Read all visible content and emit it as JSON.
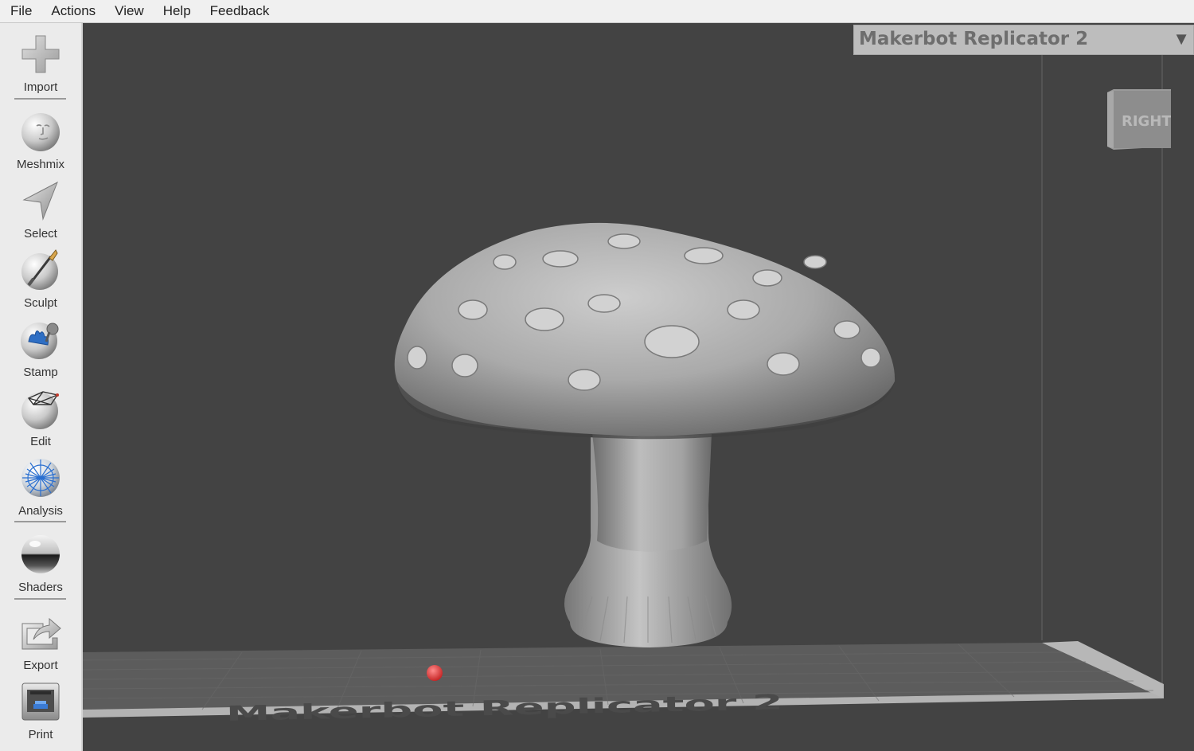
{
  "menubar": {
    "items": [
      "File",
      "Actions",
      "View",
      "Help",
      "Feedback"
    ]
  },
  "toolbar": {
    "items": [
      {
        "label": "Import",
        "icon": "plus-icon"
      },
      {
        "label": "Meshmix",
        "icon": "face-sphere-icon"
      },
      {
        "label": "Select",
        "icon": "arrow-cursor-icon"
      },
      {
        "label": "Sculpt",
        "icon": "brush-sphere-icon"
      },
      {
        "label": "Stamp",
        "icon": "stamp-sphere-icon"
      },
      {
        "label": "Edit",
        "icon": "mesh-edit-icon"
      },
      {
        "label": "Analysis",
        "icon": "mesh-analysis-icon"
      },
      {
        "label": "Shaders",
        "icon": "chrome-sphere-icon"
      },
      {
        "label": "Export",
        "icon": "export-icon"
      },
      {
        "label": "Print",
        "icon": "printer-icon"
      }
    ]
  },
  "viewport": {
    "printer_select": {
      "value": "Makerbot Replicator 2"
    },
    "view_cube": {
      "face_label": "RIGHT"
    },
    "bed_label": "Makerbot Replicator 2",
    "model": "mushroom"
  },
  "colors": {
    "background": "#434343",
    "toolbar": "#ebebeb",
    "menubar": "#f0f0f0",
    "printer_select_bg": "#bdbdbd",
    "origin_marker": "#e23a3a"
  }
}
